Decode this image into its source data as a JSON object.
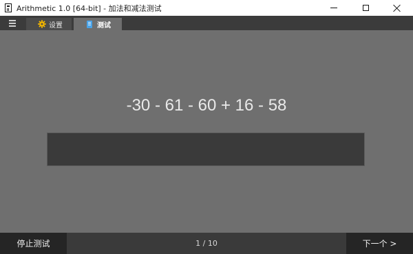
{
  "window": {
    "title": "Arithmetic 1.0  [64-bit] - 加法和减法测试"
  },
  "tabs": [
    {
      "label": "设置",
      "icon": "gear-icon"
    },
    {
      "label": "测试",
      "icon": "document-icon"
    }
  ],
  "test": {
    "expression": "-30 - 61 - 60 + 16 - 58",
    "answer_value": ""
  },
  "footer": {
    "stop_label": "停止测试",
    "progress": "1 / 10",
    "next_label": "下一个 >"
  },
  "colors": {
    "background": "#6f6f6f",
    "tabbar": "#3b3b3b",
    "answer_box": "#3a3a3a",
    "footer_buttons": "#252525",
    "gear_accent": "#f0b400",
    "doc_accent": "#4aa3e8"
  }
}
